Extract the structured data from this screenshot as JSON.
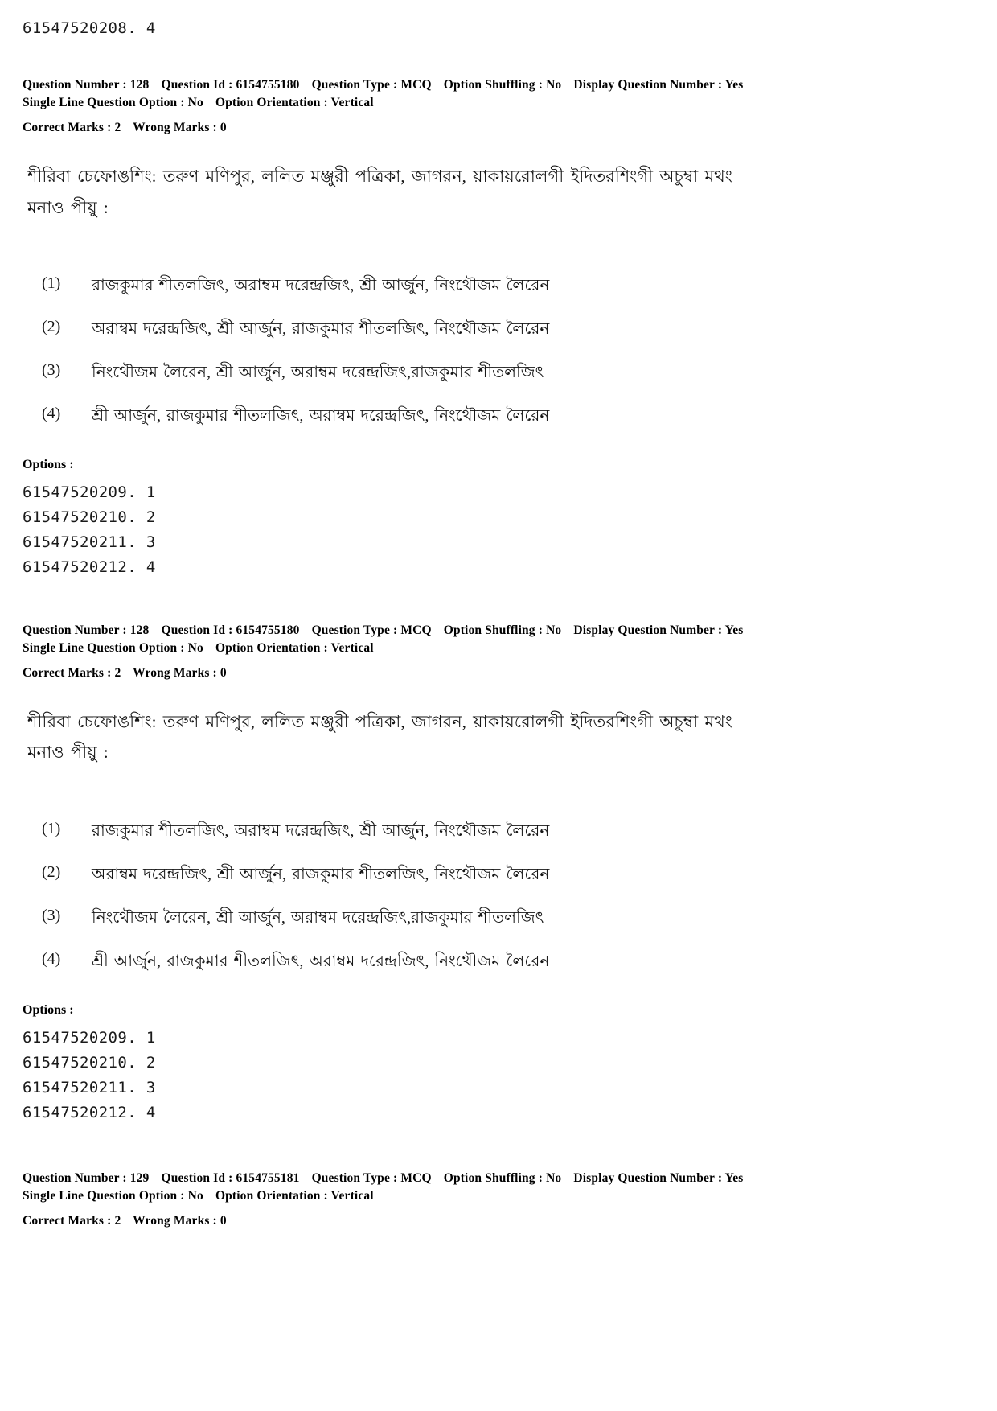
{
  "page": {
    "stray_option_id_top": "61547520208. 4"
  },
  "labels": {
    "question_number": "Question Number :",
    "question_id": "Question Id :",
    "question_type": "Question Type :",
    "option_shuffling": "Option Shuffling :",
    "display_question_number": "Display Question Number :",
    "single_line_question_option": "Single Line Question Option :",
    "option_orientation": "Option Orientation :",
    "correct_marks": "Correct Marks :",
    "wrong_marks": "Wrong Marks :",
    "options_heading": "Options :"
  },
  "questions": [
    {
      "meta": {
        "question_number": "128",
        "question_id": "6154755180",
        "question_type": "MCQ",
        "option_shuffling": "No",
        "display_question_number": "Yes",
        "single_line_question_option": "No",
        "option_orientation": "Vertical",
        "correct_marks": "2",
        "wrong_marks": "0"
      },
      "stem_line_1": "শীরিবা চেফোঙশিং: তরুণ মণিপুর, ললিত মঞ্জুরী পত্রিকা, জাগরন, য়াকায়রোলগী ইদিতরশিংগী অচুম্বা মথং",
      "stem_line_2": "মনাও পীয়ু :",
      "choices": [
        {
          "number": "(1)",
          "text": "রাজকুমার শীতলজিৎ, অরাম্বম দরেন্দ্রজিৎ, শ্রী আর্জুন, নিংথৌজম লৈরেন"
        },
        {
          "number": "(2)",
          "text": "অরাম্বম দরেন্দ্রজিৎ, শ্রী আর্জুন, রাজকুমার শীতলজিৎ, নিংথৌজম লৈরেন"
        },
        {
          "number": "(3)",
          "text": "নিংথৌজম লৈরেন, শ্রী আর্জুন, অরাম্বম দরেন্দ্রজিৎ,রাজকুমার শীতলজিৎ"
        },
        {
          "number": "(4)",
          "text": "শ্রী আর্জুন, রাজকুমার শীতলজিৎ, অরাম্বম দরেন্দ্রজিৎ, নিংথৌজম লৈরেন"
        }
      ],
      "option_ids": [
        "61547520209. 1",
        "61547520210. 2",
        "61547520211. 3",
        "61547520212. 4"
      ]
    },
    {
      "meta": {
        "question_number": "128",
        "question_id": "6154755180",
        "question_type": "MCQ",
        "option_shuffling": "No",
        "display_question_number": "Yes",
        "single_line_question_option": "No",
        "option_orientation": "Vertical",
        "correct_marks": "2",
        "wrong_marks": "0"
      },
      "stem_line_1": "শীরিবা চেফোঙশিং: তরুণ মণিপুর, ললিত মঞ্জুরী পত্রিকা, জাগরন, য়াকায়রোলগী ইদিতরশিংগী অচুম্বা মথং",
      "stem_line_2": "মনাও পীয়ু :",
      "choices": [
        {
          "number": "(1)",
          "text": "রাজকুমার শীতলজিৎ, অরাম্বম দরেন্দ্রজিৎ, শ্রী আর্জুন, নিংথৌজম লৈরেন"
        },
        {
          "number": "(2)",
          "text": "অরাম্বম দরেন্দ্রজিৎ, শ্রী আর্জুন, রাজকুমার শীতলজিৎ, নিংথৌজম লৈরেন"
        },
        {
          "number": "(3)",
          "text": "নিংথৌজম লৈরেন, শ্রী আর্জুন, অরাম্বম দরেন্দ্রজিৎ,রাজকুমার শীতলজিৎ"
        },
        {
          "number": "(4)",
          "text": "শ্রী আর্জুন, রাজকুমার শীতলজিৎ, অরাম্বম দরেন্দ্রজিৎ, নিংথৌজম লৈরেন"
        }
      ],
      "option_ids": [
        "61547520209. 1",
        "61547520210. 2",
        "61547520211. 3",
        "61547520212. 4"
      ]
    },
    {
      "meta": {
        "question_number": "129",
        "question_id": "6154755181",
        "question_type": "MCQ",
        "option_shuffling": "No",
        "display_question_number": "Yes",
        "single_line_question_option": "No",
        "option_orientation": "Vertical",
        "correct_marks": "2",
        "wrong_marks": "0"
      }
    }
  ]
}
